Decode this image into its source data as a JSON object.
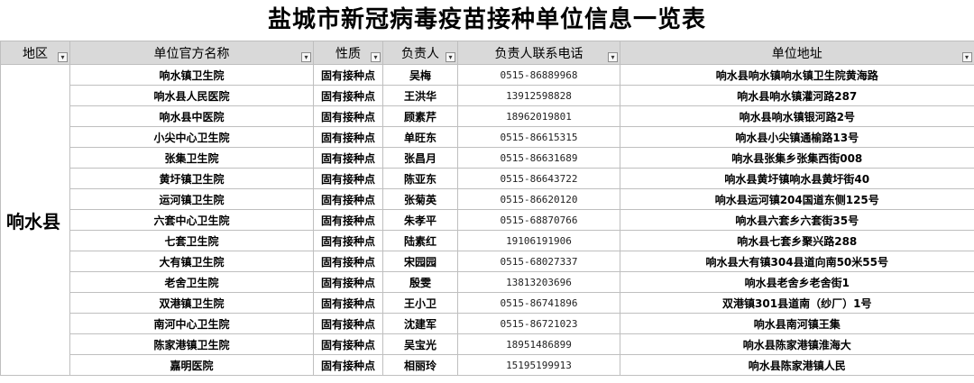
{
  "title": "盐城市新冠病毒疫苗接种单位信息一览表",
  "headers": {
    "region": "地区",
    "unit_name": "单位官方名称",
    "nature": "性质",
    "person": "负责人",
    "phone": "负责人联系电话",
    "address": "单位地址"
  },
  "filter_glyph": "▾",
  "region_value": "响水县",
  "rows": [
    {
      "name": "响水镇卫生院",
      "nature": "固有接种点",
      "person": "吴梅",
      "phone": "0515-86889968",
      "address": "响水县响水镇响水镇卫生院黄海路"
    },
    {
      "name": "响水县人民医院",
      "nature": "固有接种点",
      "person": "王洪华",
      "phone": "13912598828",
      "address": "响水县响水镇灌河路287"
    },
    {
      "name": "响水县中医院",
      "nature": "固有接种点",
      "person": "顾素芹",
      "phone": "18962019801",
      "address": "响水县响水镇银河路2号"
    },
    {
      "name": "小尖中心卫生院",
      "nature": "固有接种点",
      "person": "单旺东",
      "phone": "0515-86615315",
      "address": "响水县小尖镇通榆路13号"
    },
    {
      "name": "张集卫生院",
      "nature": "固有接种点",
      "person": "张昌月",
      "phone": "0515-86631689",
      "address": "响水县张集乡张集西街008"
    },
    {
      "name": "黄圩镇卫生院",
      "nature": "固有接种点",
      "person": "陈亚东",
      "phone": "0515-86643722",
      "address": "响水县黄圩镇响水县黄圩街40"
    },
    {
      "name": "运河镇卫生院",
      "nature": "固有接种点",
      "person": "张菊英",
      "phone": "0515-86620120",
      "address": "响水县运河镇204国道东侧125号"
    },
    {
      "name": "六套中心卫生院",
      "nature": "固有接种点",
      "person": "朱孝平",
      "phone": "0515-68870766",
      "address": "响水县六套乡六套街35号"
    },
    {
      "name": "七套卫生院",
      "nature": "固有接种点",
      "person": "陆素红",
      "phone": "19106191906",
      "address": "响水县七套乡聚兴路288"
    },
    {
      "name": "大有镇卫生院",
      "nature": "固有接种点",
      "person": "宋园园",
      "phone": "0515-68027337",
      "address": "响水县大有镇304县道向南50米55号"
    },
    {
      "name": "老舍卫生院",
      "nature": "固有接种点",
      "person": "殷雯",
      "phone": "13813203696",
      "address": "响水县老舍乡老舍街1"
    },
    {
      "name": "双港镇卫生院",
      "nature": "固有接种点",
      "person": "王小卫",
      "phone": "0515-86741896",
      "address": "双港镇301县道南（纱厂）1号"
    },
    {
      "name": "南河中心卫生院",
      "nature": "固有接种点",
      "person": "沈建军",
      "phone": "0515-86721023",
      "address": "响水县南河镇王集"
    },
    {
      "name": "陈家港镇卫生院",
      "nature": "固有接种点",
      "person": "吴宝光",
      "phone": "18951486899",
      "address": "响水县陈家港镇淮海大"
    },
    {
      "name": "嘉明医院",
      "nature": "固有接种点",
      "person": "相丽玲",
      "phone": "15195199913",
      "address": "响水县陈家港镇人民"
    }
  ]
}
